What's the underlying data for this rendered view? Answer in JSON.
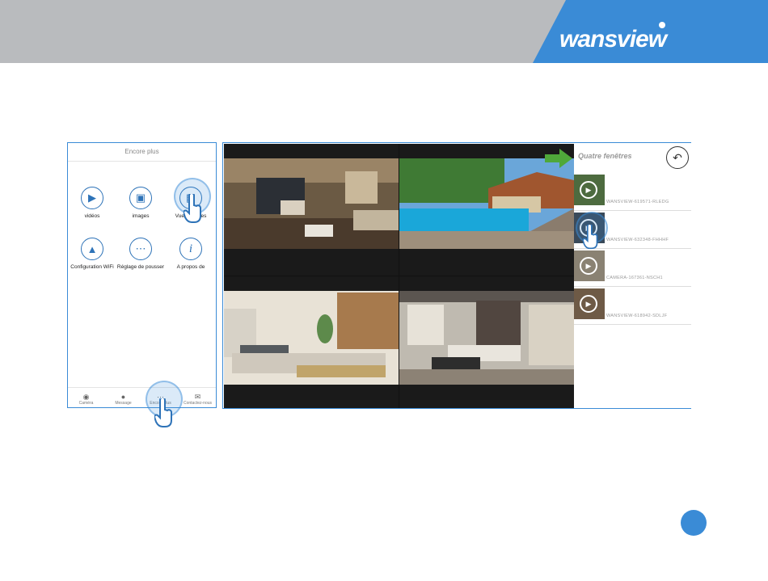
{
  "brand": {
    "logo_text": "wansview"
  },
  "colors": {
    "header_gray": "#b9bbbe",
    "brand_blue": "#3a8bd6",
    "icon_blue": "#2e73b8"
  },
  "phone": {
    "title": "Encore plus",
    "menu": [
      {
        "label": "vidéos",
        "icon": "video-icon"
      },
      {
        "label": "images",
        "icon": "image-icon"
      },
      {
        "label": "Vue multiples",
        "icon": "grid-icon"
      },
      {
        "label": "Configuration WiFi",
        "icon": "wifi-icon"
      },
      {
        "label": "Réglage de pousser",
        "icon": "push-icon"
      },
      {
        "label": "A propos de",
        "icon": "info-icon"
      }
    ],
    "tabs": [
      {
        "label": "Caméra",
        "icon": "eye-icon"
      },
      {
        "label": "Message",
        "icon": "message-icon"
      },
      {
        "label": "Encore plus",
        "icon": "more-icon"
      },
      {
        "label": "Contactez-nous",
        "icon": "mail-icon"
      }
    ]
  },
  "viewer": {
    "side_title": "Quatre fenêtres",
    "cameras": [
      {
        "name": "WANSVIEW-619571-RLEDG"
      },
      {
        "name": "WANSVIEW-632348-FHHHF"
      },
      {
        "name": "CAMERA-167361-NSCH1"
      },
      {
        "name": "WANSVIEW-618942-SDLJF"
      }
    ]
  }
}
